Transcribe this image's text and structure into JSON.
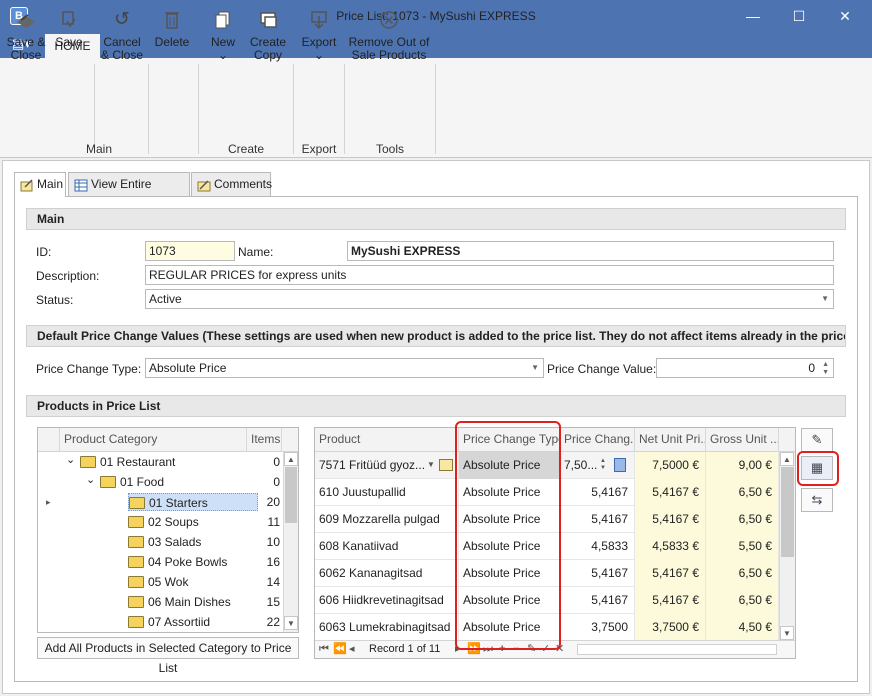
{
  "window": {
    "app_icon_letter": "B",
    "title": "Price List: 1073 - MySushi EXPRESS",
    "minimize": "—",
    "maximize": "☐",
    "close": "✕"
  },
  "ribbon": {
    "app_menu_icon": "▤▾",
    "tab_home": "HOME",
    "buttons": {
      "save_close": "Save &\nClose",
      "save": "Save",
      "cancel_close": "Cancel\n& Close",
      "delete": "Delete",
      "new": "New",
      "create_copy": "Create\nCopy",
      "export": "Export",
      "remove_out_of_sale": "Remove Out of\nSale Products"
    },
    "dropdown_arrow": "⌄",
    "groups": {
      "main": "Main",
      "create": "Create",
      "export": "Export",
      "tools": "Tools"
    }
  },
  "doc_tabs": {
    "main": "Main",
    "view_entire": "View Entire Pricelist",
    "comments": "Comments"
  },
  "main_section": {
    "title": "Main",
    "id_label": "ID:",
    "id_value": "1073",
    "name_label": "Name:",
    "name_value": "MySushi EXPRESS",
    "description_label": "Description:",
    "description_value": "REGULAR PRICES for express units",
    "status_label": "Status:",
    "status_value": "Active"
  },
  "default_section": {
    "title": "Default Price Change Values (These settings are used when new product is added to the price list. They do not affect items already in the price",
    "type_label": "Price Change Type:",
    "type_value": "Absolute Price",
    "value_label": "Price Change Value:",
    "value_value": "0"
  },
  "products_section": {
    "title": "Products in Price List",
    "tree": {
      "col_category": "Product Category",
      "col_items": "Items",
      "rows": [
        {
          "expander": "⌄",
          "label": "01 Restaurant",
          "items": "0"
        },
        {
          "expander": "⌄",
          "label": "01 Food",
          "items": "0"
        },
        {
          "expander": "",
          "label": "01 Starters",
          "items": "20"
        },
        {
          "expander": "",
          "label": "02 Soups",
          "items": "11"
        },
        {
          "expander": "",
          "label": "03 Salads",
          "items": "10"
        },
        {
          "expander": "",
          "label": "04 Poke Bowls",
          "items": "16"
        },
        {
          "expander": "",
          "label": "05 Wok",
          "items": "14"
        },
        {
          "expander": "",
          "label": "06 Main Dishes",
          "items": "15"
        },
        {
          "expander": "",
          "label": "07 Assortiid",
          "items": "22"
        }
      ],
      "row_indicator": "▸",
      "add_button": "Add All Products in Selected Category to Price List"
    },
    "grid": {
      "col_product": "Product",
      "col_type": "Price Change Type",
      "col_change": "Price Chang...",
      "col_net": "Net Unit Pri...",
      "col_gross": "Gross Unit ...",
      "rows": [
        {
          "product": "7571 Fritüüd gyoz...",
          "type": "Absolute Price",
          "change": "7,50...",
          "net": "7,5000 €",
          "gross": "9,00 €"
        },
        {
          "product": "610 Juustupallid",
          "type": "Absolute Price",
          "change": "5,4167",
          "net": "5,4167 €",
          "gross": "6,50 €"
        },
        {
          "product": "609 Mozzarella pulgad",
          "type": "Absolute Price",
          "change": "5,4167",
          "net": "5,4167 €",
          "gross": "6,50 €"
        },
        {
          "product": "608 Kanatiivad",
          "type": "Absolute Price",
          "change": "4,5833",
          "net": "4,5833 €",
          "gross": "5,50 €"
        },
        {
          "product": "6062 Kananagitsad",
          "type": "Absolute Price",
          "change": "5,4167",
          "net": "5,4167 €",
          "gross": "6,50 €"
        },
        {
          "product": "606 Hiidkrevetinagitsad",
          "type": "Absolute Price",
          "change": "5,4167",
          "net": "5,4167 €",
          "gross": "6,50 €"
        },
        {
          "product": "6063 Lumekrabinagitsad",
          "type": "Absolute Price",
          "change": "3,7500",
          "net": "3,7500 €",
          "gross": "4,50 €"
        }
      ],
      "navigator": {
        "first": "⏮",
        "prev_page": "⏪",
        "prev": "◂",
        "record_text": "Record 1 of 11",
        "next": "▸",
        "next_page": "⏩",
        "last": "⏭",
        "add": "+",
        "remove": "−",
        "edit": "✎",
        "accept": "✓",
        "cancel": "✕"
      }
    },
    "side_buttons": {
      "edit_icon": "✎",
      "calculator_icon": "▦",
      "transfer_icon": "⇆"
    }
  },
  "colors": {
    "titlebar": "#4d73b0",
    "highlight_red": "#e02020",
    "selected_row": "#cde0f7"
  }
}
